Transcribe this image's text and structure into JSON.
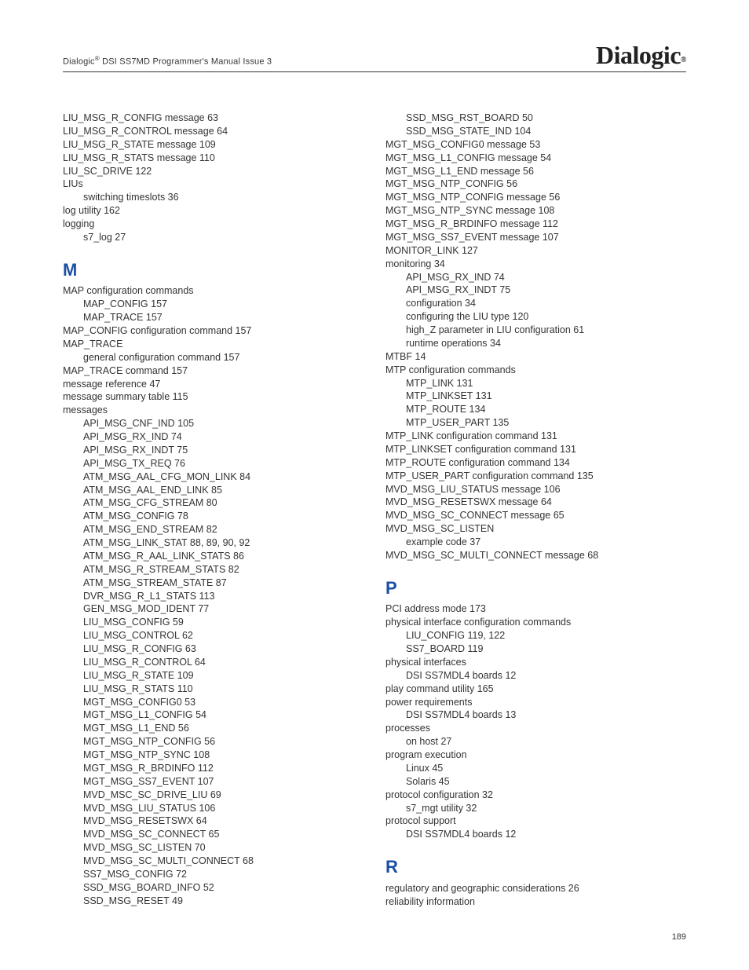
{
  "header_text": "Dialogic® DSI SS7MD Programmer's Manual Issue 3",
  "logo": "Dialogic",
  "logo_sub": "®",
  "page_number": "189",
  "col1": [
    {
      "t": "e",
      "v": "LIU_MSG_R_CONFIG message 63"
    },
    {
      "t": "e",
      "v": "LIU_MSG_R_CONTROL message 64"
    },
    {
      "t": "e",
      "v": "LIU_MSG_R_STATE message 109"
    },
    {
      "t": "e",
      "v": "LIU_MSG_R_STATS message 110"
    },
    {
      "t": "e",
      "v": "LIU_SC_DRIVE 122"
    },
    {
      "t": "e",
      "v": "LIUs"
    },
    {
      "t": "i",
      "v": "switching timeslots 36"
    },
    {
      "t": "e",
      "v": "log utility 162"
    },
    {
      "t": "e",
      "v": "logging"
    },
    {
      "t": "i",
      "v": "s7_log 27"
    },
    {
      "t": "L",
      "v": "M"
    },
    {
      "t": "e",
      "v": "MAP configuration commands"
    },
    {
      "t": "i",
      "v": "MAP_CONFIG 157"
    },
    {
      "t": "i",
      "v": "MAP_TRACE 157"
    },
    {
      "t": "e",
      "v": "MAP_CONFIG configuration command 157"
    },
    {
      "t": "e",
      "v": "MAP_TRACE"
    },
    {
      "t": "i",
      "v": "general configuration command 157"
    },
    {
      "t": "e",
      "v": "MAP_TRACE command 157"
    },
    {
      "t": "e",
      "v": "message reference 47"
    },
    {
      "t": "e",
      "v": "message summary table 115"
    },
    {
      "t": "e",
      "v": "messages"
    },
    {
      "t": "i",
      "v": "API_MSG_CNF_IND 105"
    },
    {
      "t": "i",
      "v": "API_MSG_RX_IND 74"
    },
    {
      "t": "i",
      "v": "API_MSG_RX_INDT 75"
    },
    {
      "t": "i",
      "v": "API_MSG_TX_REQ 76"
    },
    {
      "t": "i",
      "v": "ATM_MSG_AAL_CFG_MON_LINK 84"
    },
    {
      "t": "i",
      "v": "ATM_MSG_AAL_END_LINK 85"
    },
    {
      "t": "i",
      "v": "ATM_MSG_CFG_STREAM 80"
    },
    {
      "t": "i",
      "v": "ATM_MSG_CONFIG 78"
    },
    {
      "t": "i",
      "v": "ATM_MSG_END_STREAM 82"
    },
    {
      "t": "i",
      "v": "ATM_MSG_LINK_STAT 88, 89, 90, 92"
    },
    {
      "t": "i",
      "v": "ATM_MSG_R_AAL_LINK_STATS 86"
    },
    {
      "t": "i",
      "v": "ATM_MSG_R_STREAM_STATS 82"
    },
    {
      "t": "i",
      "v": "ATM_MSG_STREAM_STATE 87"
    },
    {
      "t": "i",
      "v": "DVR_MSG_R_L1_STATS 113"
    },
    {
      "t": "i",
      "v": "GEN_MSG_MOD_IDENT 77"
    },
    {
      "t": "i",
      "v": "LIU_MSG_CONFIG 59"
    },
    {
      "t": "i",
      "v": "LIU_MSG_CONTROL 62"
    },
    {
      "t": "i",
      "v": "LIU_MSG_R_CONFIG 63"
    },
    {
      "t": "i",
      "v": "LIU_MSG_R_CONTROL 64"
    },
    {
      "t": "i",
      "v": "LIU_MSG_R_STATE 109"
    },
    {
      "t": "i",
      "v": "LIU_MSG_R_STATS 110"
    },
    {
      "t": "i",
      "v": "MGT_MSG_CONFIG0 53"
    },
    {
      "t": "i",
      "v": "MGT_MSG_L1_CONFIG 54"
    },
    {
      "t": "i",
      "v": "MGT_MSG_L1_END 56"
    },
    {
      "t": "i",
      "v": "MGT_MSG_NTP_CONFIG 56"
    },
    {
      "t": "i",
      "v": "MGT_MSG_NTP_SYNC 108"
    },
    {
      "t": "i",
      "v": "MGT_MSG_R_BRDINFO 112"
    },
    {
      "t": "i",
      "v": "MGT_MSG_SS7_EVENT 107"
    },
    {
      "t": "i",
      "v": "MVD_MSC_SC_DRIVE_LIU 69"
    },
    {
      "t": "i",
      "v": "MVD_MSG_LIU_STATUS 106"
    },
    {
      "t": "i",
      "v": "MVD_MSG_RESETSWX 64"
    },
    {
      "t": "i",
      "v": "MVD_MSG_SC_CONNECT 65"
    },
    {
      "t": "i",
      "v": "MVD_MSG_SC_LISTEN 70"
    },
    {
      "t": "i",
      "v": "MVD_MSG_SC_MULTI_CONNECT 68"
    },
    {
      "t": "i",
      "v": "SS7_MSG_CONFIG 72"
    },
    {
      "t": "i",
      "v": "SSD_MSG_BOARD_INFO 52"
    },
    {
      "t": "i",
      "v": "SSD_MSG_RESET 49"
    }
  ],
  "col2": [
    {
      "t": "i",
      "v": "SSD_MSG_RST_BOARD 50"
    },
    {
      "t": "i",
      "v": "SSD_MSG_STATE_IND 104"
    },
    {
      "t": "e",
      "v": "MGT_MSG_CONFIG0 message 53"
    },
    {
      "t": "e",
      "v": "MGT_MSG_L1_CONFIG message 54"
    },
    {
      "t": "e",
      "v": "MGT_MSG_L1_END message 56"
    },
    {
      "t": "e",
      "v": "MGT_MSG_NTP_CONFIG 56"
    },
    {
      "t": "e",
      "v": "MGT_MSG_NTP_CONFIG message 56"
    },
    {
      "t": "e",
      "v": "MGT_MSG_NTP_SYNC message 108"
    },
    {
      "t": "e",
      "v": "MGT_MSG_R_BRDINFO message 112"
    },
    {
      "t": "e",
      "v": "MGT_MSG_SS7_EVENT message 107"
    },
    {
      "t": "e",
      "v": "MONITOR_LINK 127"
    },
    {
      "t": "e",
      "v": "monitoring 34"
    },
    {
      "t": "i",
      "v": "API_MSG_RX_IND 74"
    },
    {
      "t": "i",
      "v": "API_MSG_RX_INDT 75"
    },
    {
      "t": "i",
      "v": "configuration 34"
    },
    {
      "t": "i",
      "v": "configuring the LIU type 120"
    },
    {
      "t": "i",
      "v": "high_Z parameter in LIU configuration 61"
    },
    {
      "t": "i",
      "v": "runtime operations 34"
    },
    {
      "t": "e",
      "v": "MTBF 14"
    },
    {
      "t": "e",
      "v": "MTP configuration commands"
    },
    {
      "t": "i",
      "v": "MTP_LINK 131"
    },
    {
      "t": "i",
      "v": "MTP_LINKSET 131"
    },
    {
      "t": "i",
      "v": "MTP_ROUTE 134"
    },
    {
      "t": "i",
      "v": "MTP_USER_PART 135"
    },
    {
      "t": "e",
      "v": "MTP_LINK configuration command 131"
    },
    {
      "t": "e",
      "v": "MTP_LINKSET configuration command 131"
    },
    {
      "t": "e",
      "v": "MTP_ROUTE configuration command 134"
    },
    {
      "t": "e",
      "v": "MTP_USER_PART configuration command 135"
    },
    {
      "t": "e",
      "v": "MVD_MSG_LIU_STATUS message 106"
    },
    {
      "t": "e",
      "v": "MVD_MSG_RESETSWX message 64"
    },
    {
      "t": "e",
      "v": "MVD_MSG_SC_CONNECT message 65"
    },
    {
      "t": "e",
      "v": "MVD_MSG_SC_LISTEN"
    },
    {
      "t": "i",
      "v": "example code 37"
    },
    {
      "t": "e",
      "v": "MVD_MSG_SC_MULTI_CONNECT message 68"
    },
    {
      "t": "L",
      "v": "P"
    },
    {
      "t": "e",
      "v": "PCI address mode 173"
    },
    {
      "t": "e",
      "v": "physical interface configuration commands"
    },
    {
      "t": "i",
      "v": "LIU_CONFIG 119, 122"
    },
    {
      "t": "i",
      "v": "SS7_BOARD 119"
    },
    {
      "t": "e",
      "v": "physical interfaces"
    },
    {
      "t": "i",
      "v": "DSI SS7MDL4 boards 12"
    },
    {
      "t": "e",
      "v": "play command utility 165"
    },
    {
      "t": "e",
      "v": "power requirements"
    },
    {
      "t": "i",
      "v": "DSI SS7MDL4 boards 13"
    },
    {
      "t": "e",
      "v": "processes"
    },
    {
      "t": "i",
      "v": "on host 27"
    },
    {
      "t": "e",
      "v": "program execution"
    },
    {
      "t": "i",
      "v": "Linux 45"
    },
    {
      "t": "i",
      "v": "Solaris 45"
    },
    {
      "t": "e",
      "v": "protocol configuration 32"
    },
    {
      "t": "i",
      "v": "s7_mgt utility 32"
    },
    {
      "t": "e",
      "v": "protocol support"
    },
    {
      "t": "i",
      "v": "DSI SS7MDL4 boards 12"
    },
    {
      "t": "L",
      "v": "R"
    },
    {
      "t": "e",
      "v": "regulatory and geographic considerations 26"
    },
    {
      "t": "e",
      "v": "reliability information"
    }
  ]
}
